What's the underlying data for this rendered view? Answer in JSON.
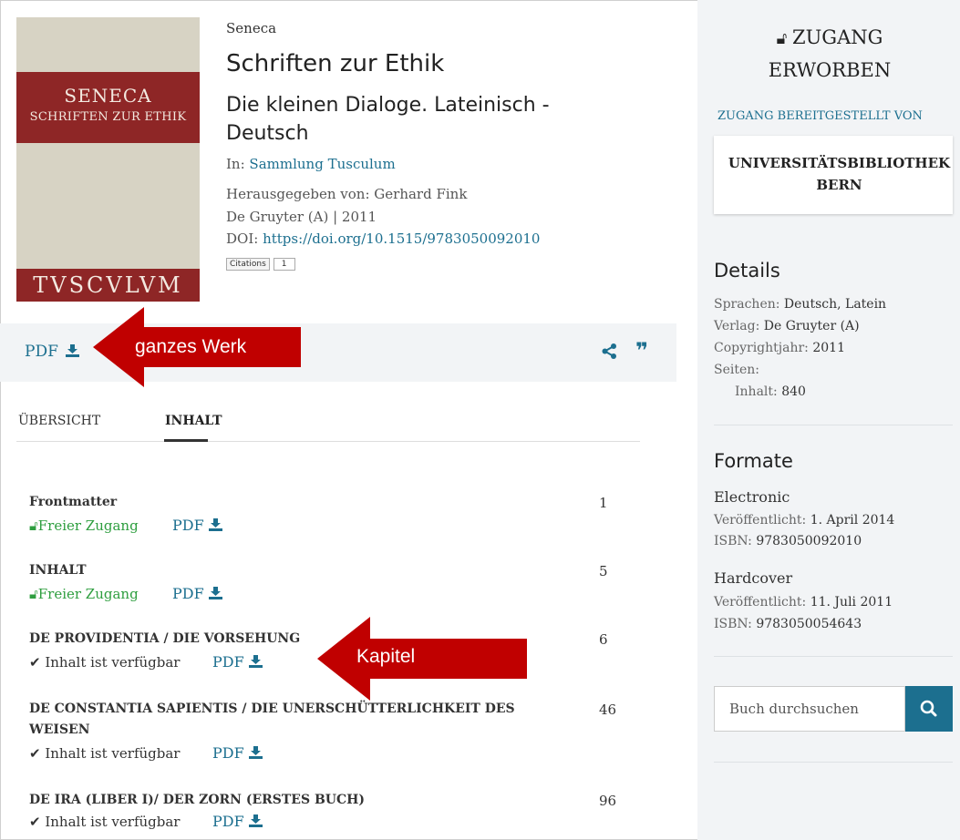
{
  "cover": {
    "line1": "SENECA",
    "line2": "SCHRIFTEN ZUR ETHIK",
    "line3": "TVSCVLVM",
    "colors": {
      "background": "#d7d3c4",
      "band": "#8e2626"
    }
  },
  "book": {
    "author": "Seneca",
    "title": "Schriften zur Ethik",
    "subtitle": "Die kleinen Dialoge. Lateinisch - Deutsch",
    "series_prefix": "In: ",
    "series": "Sammlung Tusculum",
    "editor": "Herausgegeben von: Gerhard Fink",
    "publisher_year": "De Gruyter (A) | 2011",
    "doi_label": "DOI: ",
    "doi": "https://doi.org/10.1515/9783050092010",
    "citations_label": "Citations",
    "citations_count": "1"
  },
  "actions": {
    "pdf_label": "PDF",
    "share_icon": "share-icon",
    "cite_icon": "quote-icon"
  },
  "annotations": {
    "whole_work": "ganzes Werk",
    "chapter": "Kapitel",
    "arrow_color": "#c00000"
  },
  "tabs": [
    {
      "label": "ÜBERSICHT",
      "active": false
    },
    {
      "label": "INHALT",
      "active": true
    }
  ],
  "chapters": [
    {
      "title": "Frontmatter",
      "page": "1",
      "access": "Freier Zugang",
      "access_type": "free",
      "pdf": "PDF"
    },
    {
      "title": "INHALT",
      "page": "5",
      "access": "Freier Zugang",
      "access_type": "free",
      "pdf": "PDF"
    },
    {
      "title": "DE PROVIDENTIA / DIE VORSEHUNG",
      "page": "6",
      "access": "Inhalt ist verfügbar",
      "access_type": "available",
      "pdf": "PDF"
    },
    {
      "title_line1": "DE CONSTANTIA SAPIENTIS / DIE UNERSCHÜTTERLICHKEIT DES",
      "title_line2": "WEISEN",
      "page": "46",
      "access": "Inhalt ist verfügbar",
      "access_type": "available",
      "pdf": "PDF"
    },
    {
      "title": "DE IRA (LIBER I)/ DER ZORN (ERSTES BUCH)",
      "page": "96",
      "access": "Inhalt ist verfügbar",
      "access_type": "available",
      "pdf": "PDF"
    }
  ],
  "sidebar": {
    "access_line1": "ZUGANG",
    "access_line2": "ERWORBEN",
    "provided_by": "ZUGANG BEREITGESTELLT VON",
    "institution_line1": "UNIVERSITÄTSBIBLIOTHEK",
    "institution_line2": "BERN",
    "details_heading": "Details",
    "details": {
      "languages_label": "Sprachen: ",
      "languages": "Deutsch, Latein",
      "publisher_label": "Verlag: ",
      "publisher": "De Gruyter (A)",
      "copyright_label": "Copyrightjahr: ",
      "copyright": "2011",
      "pages_label": "Seiten:",
      "content_label": "Inhalt: ",
      "content": "840"
    },
    "formats_heading": "Formate",
    "formats": [
      {
        "name": "Electronic",
        "published_label": "Veröffentlicht: ",
        "published": "1. April 2014",
        "isbn_label": "ISBN: ",
        "isbn": "9783050092010"
      },
      {
        "name": "Hardcover",
        "published_label": "Veröffentlicht: ",
        "published": "11. Juli 2011",
        "isbn_label": "ISBN: ",
        "isbn": "9783050054643"
      }
    ],
    "search_placeholder": "Buch durchsuchen"
  }
}
